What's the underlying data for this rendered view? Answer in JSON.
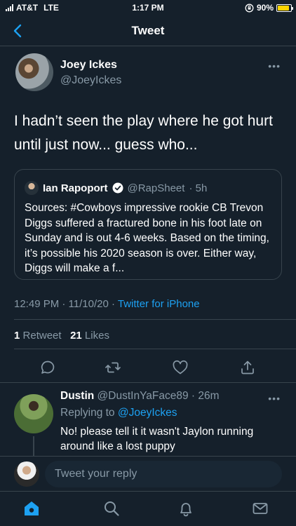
{
  "status_bar": {
    "carrier": "AT&T",
    "network": "LTE",
    "time": "1:17 PM",
    "battery": "90%",
    "battery_level": 0.9,
    "battery_color": "#ffd500"
  },
  "nav": {
    "title": "Tweet",
    "back_icon": "chevron-left-icon"
  },
  "tweet": {
    "author_name": "Joey Ickes",
    "author_handle": "@JoeyIckes",
    "text": "I hadn’t seen the play where he got hurt until just now... guess who...",
    "more_icon": "ellipsis-icon",
    "quoted": {
      "name": "Ian Rapoport",
      "verified": true,
      "handle": "@RapSheet",
      "time": "· 5h",
      "text": "Sources: #Cowboys impressive rookie CB Trevon Diggs suffered a fractured bone in his foot late on Sunday and is out 4-6 weeks. Based on the timing, it’s possible his 2020 season is over. Either way, Diggs will make a f..."
    },
    "timestamp": "12:49 PM · 11/10/20 · ",
    "source": "Twitter for iPhone",
    "retweets_count": "1",
    "retweets_label": "Retweet",
    "likes_count": "21",
    "likes_label": "Likes",
    "actions": [
      "reply-icon",
      "retweet-icon",
      "like-icon",
      "share-icon"
    ]
  },
  "reply": {
    "name": "Dustin",
    "handle_time": "@DustInYaFace89 · 26m",
    "replying_prefix": "Replying to ",
    "replying_to": "@JoeyIckes",
    "text": "No! please tell it it wasn't Jaylon running around like a lost puppy"
  },
  "composer": {
    "placeholder": "Tweet your reply"
  },
  "tabs": [
    "home-icon",
    "search-icon",
    "notifications-icon",
    "messages-icon"
  ],
  "colors": {
    "background": "#15202b",
    "accent": "#1da1f2",
    "muted": "#8899a6",
    "border": "#38444d"
  }
}
